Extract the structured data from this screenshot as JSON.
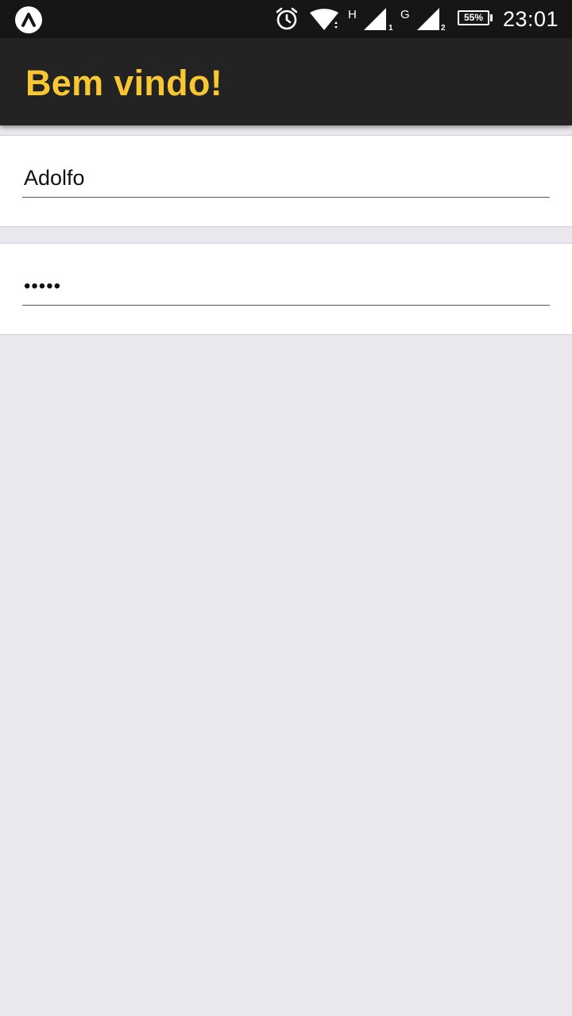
{
  "status_bar": {
    "network_type_1": "H",
    "sim_1": "1",
    "network_type_2": "G",
    "sim_2": "2",
    "battery": "55%",
    "time": "23:01",
    "icons": [
      "app-notification-icon",
      "alarm-icon",
      "wifi-icon",
      "signal-icon",
      "battery-icon"
    ]
  },
  "header": {
    "title": "Bem vindo!"
  },
  "form": {
    "username_value": "Adolfo",
    "password_value": "•••••"
  },
  "colors": {
    "status_bar_bg": "#161616",
    "header_bg": "#232323",
    "title_color": "#f9c731",
    "page_bg": "#e9e8ee"
  }
}
